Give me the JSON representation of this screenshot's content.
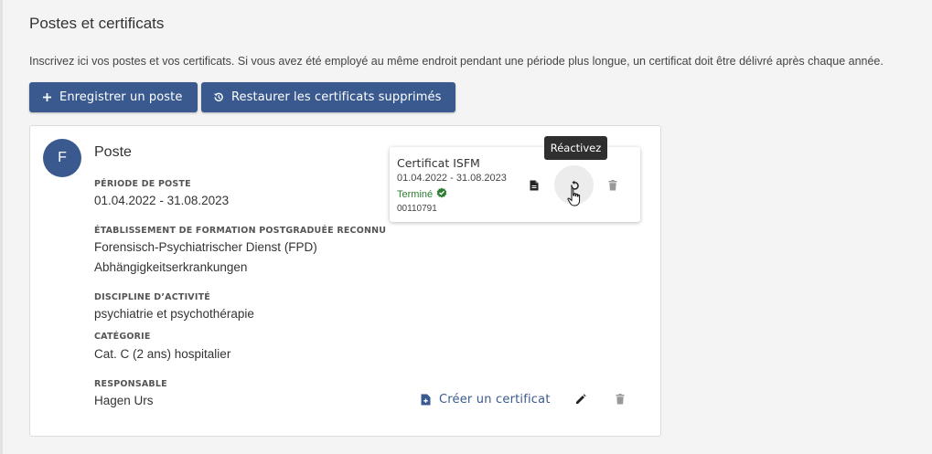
{
  "page": {
    "title": "Postes et certificats",
    "intro": "Inscrivez ici vos postes et vos certificats. Si vous avez été employé au même endroit pendant une période plus longue, un certificat doit être délivré après chaque année."
  },
  "toolbar": {
    "add_label": "Enregistrer un poste",
    "restore_label": "Restaurer les certificats supprimés"
  },
  "poste": {
    "avatar": "F",
    "title": "Poste",
    "period_label": "PÉRIODE DE POSTE",
    "period": "01.04.2022 - 31.08.2023",
    "institution_label": "ÉTABLISSEMENT DE FORMATION POSTGRADUÉE RECONNU",
    "institution_line1": "Forensisch-Psychiatrischer Dienst (FPD)",
    "institution_line2": "Abhängigkeitserkrankungen",
    "discipline_label": "DISCIPLINE D’ACTIVITÉ",
    "discipline": "psychiatrie et psychothérapie",
    "category_label": "CATÉGORIE",
    "category": "Cat. C (2 ans) hospitalier",
    "responsible_label": "RESPONSABLE",
    "responsible": "Hagen Urs",
    "create_cert_label": "Créer un certificat"
  },
  "certificate": {
    "title": "Certificat ISFM",
    "dates": "01.04.2022 - 31.08.2023",
    "status": "Terminé",
    "number": "00110791"
  },
  "tooltip": "Réactivez",
  "colors": {
    "primary": "#3a5a8f",
    "success": "#2e7d32",
    "tooltip_bg": "#2f2f2f"
  }
}
